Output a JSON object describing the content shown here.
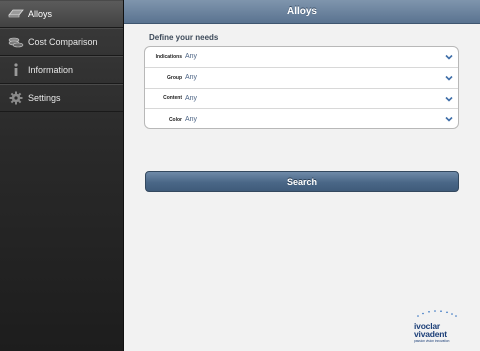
{
  "sidebar": {
    "items": [
      {
        "label": "Alloys",
        "icon": "alloys-icon",
        "active": true
      },
      {
        "label": "Cost Comparison",
        "icon": "coins-icon"
      },
      {
        "label": "Information",
        "icon": "info-icon"
      },
      {
        "label": "Settings",
        "icon": "gear-icon"
      }
    ]
  },
  "header": {
    "title": "Alloys"
  },
  "form": {
    "section_title": "Define your needs",
    "fields": [
      {
        "label": "Indications",
        "value": "Any"
      },
      {
        "label": "Group",
        "value": "Any"
      },
      {
        "label": "Content",
        "value": "Any"
      },
      {
        "label": "Color",
        "value": "Any"
      }
    ],
    "search_label": "Search"
  },
  "brand": {
    "line1": "ivoclar",
    "line2": "vivadent",
    "tagline": "passion vision innovation"
  },
  "colors": {
    "accent": "#5a7390",
    "sidebar": "#2a2a2a",
    "brand": "#1c3f78"
  }
}
